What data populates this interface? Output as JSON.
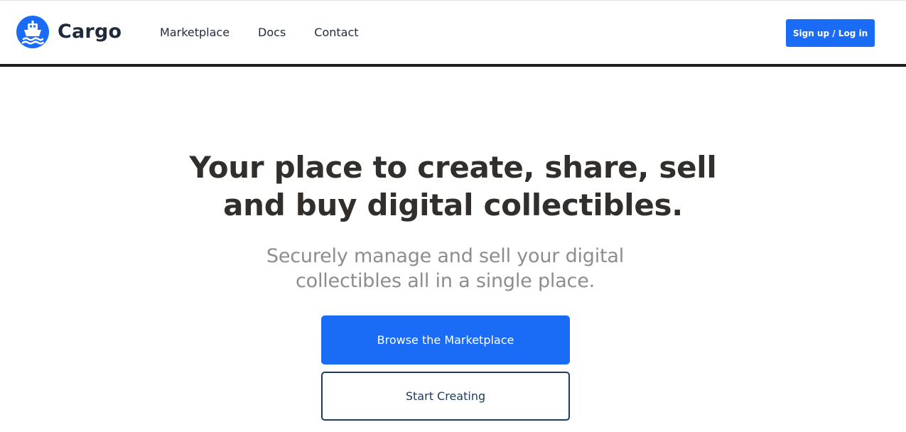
{
  "colors": {
    "brand_blue": "#1a6cf6",
    "heading_text": "#322e2c",
    "subtitle_text": "#8d8d8d",
    "outline_navy": "#1f3a5a",
    "header_border": "#1f1f1f"
  },
  "header": {
    "logo_icon": "boat-icon",
    "logo_text": "Cargo",
    "nav": [
      {
        "label": "Marketplace"
      },
      {
        "label": "Docs"
      },
      {
        "label": "Contact"
      }
    ],
    "signup_label": "Sign up / Log in"
  },
  "hero": {
    "title_line1": "Your place to create, share, sell",
    "title_line2": "and buy digital collectibles.",
    "subtitle_line1": "Securely manage and sell your digital",
    "subtitle_line2": "collectibles all in a single place.",
    "primary_button": "Browse the Marketplace",
    "secondary_button": "Start Creating"
  }
}
